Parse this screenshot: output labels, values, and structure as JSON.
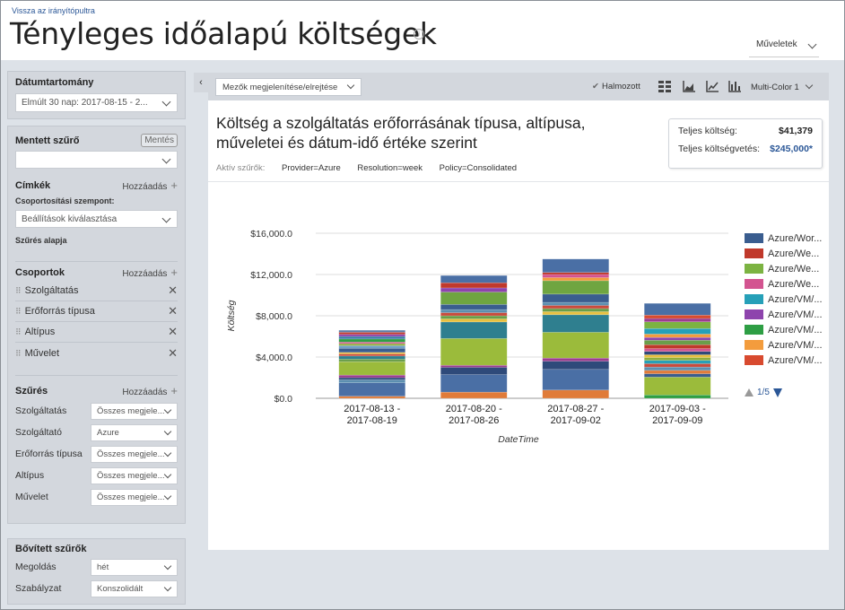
{
  "header": {
    "back_link": "Vissza az irányítópultra",
    "title": "Tényleges időalapú költségek",
    "actions_label": "Műveletek"
  },
  "sidebar": {
    "date_range": {
      "title": "Dátumtartomány",
      "value": "Elmúlt 30 nap: 2017-08-15 - 2..."
    },
    "saved_filter": {
      "title": "Mentett szűrő",
      "save_label": "Mentés",
      "value": ""
    },
    "tags": {
      "title": "Címkék",
      "add_label": "Hozzáadás",
      "group_by_label": "Csoportosítási szempont:",
      "select_placeholder": "Beállítások kiválasztása",
      "filter_by_label": "Szűrés alapja"
    },
    "groups": {
      "title": "Csoportok",
      "add_label": "Hozzáadás",
      "items": [
        "Szolgáltatás",
        "Erőforrás típusa",
        "Altípus",
        "Művelet"
      ]
    },
    "filters": {
      "title": "Szűrés",
      "add_label": "Hozzáadás",
      "rows": [
        {
          "label": "Szolgáltatás",
          "value": "Összes megjele..."
        },
        {
          "label": "Szolgáltató",
          "value": "Azure"
        },
        {
          "label": "Erőforrás típusa",
          "value": "Összes megjele..."
        },
        {
          "label": "Altípus",
          "value": "Összes megjele..."
        },
        {
          "label": "Művelet",
          "value": "Összes megjele..."
        }
      ]
    },
    "advanced": {
      "title": "Bővített szűrők",
      "rows": [
        {
          "label": "Megoldás",
          "value": "hét"
        },
        {
          "label": "Szabályzat",
          "value": "Konszolidált"
        }
      ]
    }
  },
  "toolbar": {
    "fields_label": "Mezők megjelenítése/elrejtése",
    "stacked_label": "Halmozott",
    "palette_label": "Multi-Color 1"
  },
  "chart_header": {
    "title": "Költség a szolgáltatás erőforrásának típusa, altípusa, műveletei és dátum-idő értéke szerint",
    "active_label": "Aktív szűrők:",
    "active": [
      "Provider=Azure",
      "Resolution=week",
      "Policy=Consolidated"
    ]
  },
  "totals": {
    "cost_label": "Teljes költség:",
    "cost_value": "$41,379",
    "budget_label": "Teljes költségvetés:",
    "budget_value": "$245,000*"
  },
  "legend": {
    "items": [
      "Azure/Wor...",
      "Azure/We...",
      "Azure/We...",
      "Azure/We...",
      "Azure/VM/...",
      "Azure/VM/...",
      "Azure/VM/...",
      "Azure/VM/...",
      "Azure/VM/..."
    ],
    "colors": [
      "#3a5d8f",
      "#c0392b",
      "#7cb342",
      "#d35490",
      "#26a0b8",
      "#8e44ad",
      "#2e9e44",
      "#f39c3d",
      "#d84a2f"
    ],
    "pager": "1/5"
  },
  "chart_data": {
    "type": "bar",
    "stacked": true,
    "xlabel": "DateTime",
    "ylabel": "Költség",
    "ylim": [
      0,
      16000
    ],
    "yticks": [
      "$0.0",
      "$4,000.0",
      "$8,000.0",
      "$12,000.0",
      "$16,000.0"
    ],
    "categories": [
      [
        "2017-08-13 -",
        "2017-08-19"
      ],
      [
        "2017-08-20 -",
        "2017-08-26"
      ],
      [
        "2017-08-27 -",
        "2017-09-02"
      ],
      [
        "2017-09-03 -",
        "2017-09-09"
      ]
    ],
    "totals": [
      6600,
      11900,
      13500,
      9200
    ],
    "segments": [
      [
        [
          200,
          "#e07b39"
        ],
        [
          1300,
          "#4a6fa5"
        ],
        [
          300,
          "#5c8fb0"
        ],
        [
          200,
          "#2e4a7a"
        ],
        [
          250,
          "#9c3d8f"
        ],
        [
          1300,
          "#9bbb3b"
        ],
        [
          250,
          "#6a9e4a"
        ],
        [
          300,
          "#2f7f8f"
        ],
        [
          200,
          "#c94b3c"
        ],
        [
          150,
          "#e8c040"
        ],
        [
          400,
          "#3a5d8f"
        ],
        [
          250,
          "#6fa0c8"
        ],
        [
          200,
          "#8fae3d"
        ],
        [
          150,
          "#d35490"
        ],
        [
          300,
          "#2e9e44"
        ],
        [
          250,
          "#3d7ea6"
        ],
        [
          200,
          "#8e44ad"
        ],
        [
          200,
          "#c0392b"
        ],
        [
          200,
          "#5e7fa8"
        ]
      ],
      [
        [
          600,
          "#e07b39"
        ],
        [
          1700,
          "#4a6fa5"
        ],
        [
          700,
          "#2e4a7a"
        ],
        [
          200,
          "#9c3d8f"
        ],
        [
          2600,
          "#9bbb3b"
        ],
        [
          1600,
          "#2f7f8f"
        ],
        [
          300,
          "#e8c040"
        ],
        [
          300,
          "#6a9e4a"
        ],
        [
          300,
          "#c94b3c"
        ],
        [
          300,
          "#5c8fb0"
        ],
        [
          500,
          "#3a5d8f"
        ],
        [
          1200,
          "#6fa541"
        ],
        [
          400,
          "#8e44ad"
        ],
        [
          500,
          "#c0392b"
        ],
        [
          700,
          "#4a6fa5"
        ]
      ],
      [
        [
          800,
          "#e07b39"
        ],
        [
          2000,
          "#4a6fa5"
        ],
        [
          800,
          "#2e4a7a"
        ],
        [
          300,
          "#9c3d8f"
        ],
        [
          2500,
          "#9bbb3b"
        ],
        [
          1700,
          "#2f7f8f"
        ],
        [
          300,
          "#e8c040"
        ],
        [
          300,
          "#6a9e4a"
        ],
        [
          300,
          "#c94b3c"
        ],
        [
          300,
          "#5c8fb0"
        ],
        [
          800,
          "#3a5d8f"
        ],
        [
          1300,
          "#6fa541"
        ],
        [
          300,
          "#f39c3d"
        ],
        [
          300,
          "#d35490"
        ],
        [
          200,
          "#c0392b"
        ],
        [
          1300,
          "#4a6fa5"
        ]
      ],
      [
        [
          300,
          "#2e9e44"
        ],
        [
          1600,
          "#9bbb3b"
        ],
        [
          300,
          "#3a5d8f"
        ],
        [
          300,
          "#e07b39"
        ],
        [
          300,
          "#5c8fb0"
        ],
        [
          300,
          "#c94b3c"
        ],
        [
          300,
          "#26a0b8"
        ],
        [
          250,
          "#8fae3d"
        ],
        [
          250,
          "#e8c040"
        ],
        [
          300,
          "#2e4a7a"
        ],
        [
          250,
          "#d35490"
        ],
        [
          350,
          "#c0392b"
        ],
        [
          400,
          "#6a9e4a"
        ],
        [
          250,
          "#8e44ad"
        ],
        [
          300,
          "#f39c3d"
        ],
        [
          500,
          "#26a0b8"
        ],
        [
          600,
          "#7cb342"
        ],
        [
          300,
          "#9c3d8f"
        ],
        [
          300,
          "#d84a2f"
        ],
        [
          1050,
          "#4a6fa5"
        ]
      ]
    ]
  }
}
